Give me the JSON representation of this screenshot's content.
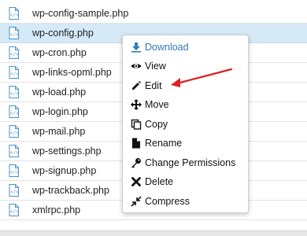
{
  "files": [
    {
      "name": "wp-config-sample.php",
      "selected": false
    },
    {
      "name": "wp-config.php",
      "selected": true
    },
    {
      "name": "wp-cron.php",
      "selected": false
    },
    {
      "name": "wp-links-opml.php",
      "selected": false
    },
    {
      "name": "wp-load.php",
      "selected": false
    },
    {
      "name": "wp-login.php",
      "selected": false
    },
    {
      "name": "wp-mail.php",
      "selected": false
    },
    {
      "name": "wp-settings.php",
      "selected": false
    },
    {
      "name": "wp-signup.php",
      "selected": false
    },
    {
      "name": "wp-trackback.php",
      "selected": false
    },
    {
      "name": "xmlrpc.php",
      "selected": false
    }
  ],
  "context_menu": {
    "items": [
      {
        "label": "Download",
        "icon": "download-icon"
      },
      {
        "label": "View",
        "icon": "eye-icon"
      },
      {
        "label": "Edit",
        "icon": "pencil-icon"
      },
      {
        "label": "Move",
        "icon": "move-icon"
      },
      {
        "label": "Copy",
        "icon": "copy-icon"
      },
      {
        "label": "Rename",
        "icon": "file-icon"
      },
      {
        "label": "Change Permissions",
        "icon": "key-icon"
      },
      {
        "label": "Delete",
        "icon": "x-icon"
      },
      {
        "label": "Compress",
        "icon": "compress-icon"
      }
    ]
  },
  "colors": {
    "selected_row": "#d5e9f7",
    "download_link": "#337ab7",
    "annotation_arrow": "#e02020",
    "file_icon": "#4a90c9"
  }
}
